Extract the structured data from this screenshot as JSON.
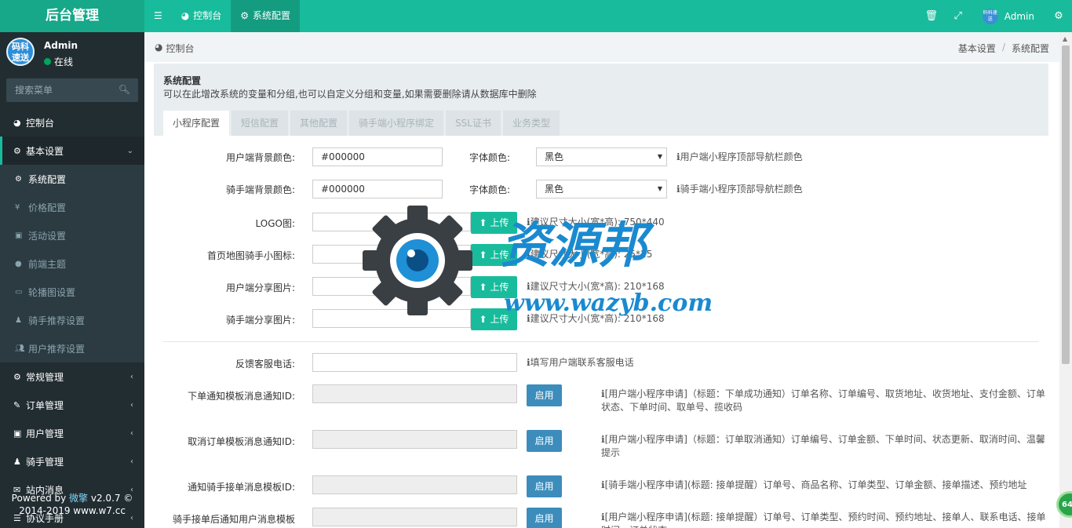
{
  "header": {
    "logo": "后台管理",
    "nav": [
      {
        "label": "控制台",
        "icon": "dashboard-icon"
      },
      {
        "label": "系统配置",
        "icon": "gear-icon"
      }
    ],
    "user_name": "Admin",
    "avatar_text": "码科速送"
  },
  "sidebar": {
    "avatar_text": "码科速送",
    "user_name": "Admin",
    "status": "在线",
    "search_placeholder": "搜索菜单",
    "items": [
      {
        "label": "控制台",
        "icon": "dashboard-icon"
      },
      {
        "label": "基本设置",
        "icon": "gear-icon",
        "open": true
      },
      {
        "label": "常规管理",
        "icon": "gears-icon"
      },
      {
        "label": "订单管理",
        "icon": "edit-icon"
      },
      {
        "label": "用户管理",
        "icon": "user-icon"
      },
      {
        "label": "骑手管理",
        "icon": "rider-icon"
      },
      {
        "label": "站内消息",
        "icon": "message-icon"
      },
      {
        "label": "协议手册",
        "icon": "list-icon"
      }
    ],
    "sub_items": [
      {
        "label": "系统配置",
        "icon": "gear-icon",
        "active": true
      },
      {
        "label": "价格配置",
        "icon": "yen-icon"
      },
      {
        "label": "活动设置",
        "icon": "gift-icon"
      },
      {
        "label": "前端主题",
        "icon": "palette-icon"
      },
      {
        "label": "轮播图设置",
        "icon": "image-icon"
      },
      {
        "label": "骑手推荐设置",
        "icon": "rider-icon"
      },
      {
        "label": "用户推荐设置",
        "icon": "users-icon"
      }
    ],
    "powered_prefix": "Powered by ",
    "powered_brand": "微擎",
    "powered_version": " v2.0.7 ©",
    "powered_line2": "2014-2019 www.w7.cc"
  },
  "breadcrumb": {
    "left": "控制台",
    "right": [
      "基本设置",
      "系统配置"
    ]
  },
  "panel": {
    "title": "系统配置",
    "description": "可以在此增改系统的变量和分组,也可以自定义分组和变量,如果需要删除请从数据库中删除",
    "tabs": [
      "小程序配置",
      "短信配置",
      "其他配置",
      "骑手端小程序绑定",
      "SSL证书",
      "业务类型"
    ]
  },
  "form": {
    "user_bg_label": "用户端背景颜色:",
    "user_bg_value": "#000000",
    "font_color_label": "字体颜色:",
    "user_font_color": "黑色",
    "user_hint": "用户端小程序顶部导航栏颜色",
    "rider_bg_label": "骑手端背景颜色:",
    "rider_bg_value": "#000000",
    "rider_font_color": "黑色",
    "rider_hint": "骑手端小程序顶部导航栏颜色",
    "upload_label": "上传",
    "logo_label": "LOGO图:",
    "logo_hint": "建议尺寸大小(宽*高): 750*440",
    "map_icon_label": "首页地图骑手小图标:",
    "map_icon_hint": "建议尺寸大小(宽*高): 25*25",
    "user_share_label": "用户端分享图片:",
    "user_share_hint": "建议尺寸大小(宽*高): 210*168",
    "rider_share_label": "骑手端分享图片:",
    "rider_share_hint": "建议尺寸大小(宽*高): 210*168",
    "phone_label": "反馈客服电话:",
    "phone_hint": "填写用户端联系客服电话",
    "enable_label": "启用",
    "order_tpl_label": "下单通知模板消息通知ID:",
    "order_tpl_hint": "[用户端小程序申请]（标题：下单成功通知）订单名称、订单编号、取货地址、收货地址、支付金额、订单状态、下单时间、取单号、揽收码",
    "cancel_tpl_label": "取消订单模板消息通知ID:",
    "cancel_tpl_hint": "[用户端小程序申请]（标题：订单取消通知）订单编号、订单金额、下单时间、状态更新、取消时间、温馨提示",
    "rider_tpl_label": "通知骑手接单消息模板ID:",
    "rider_tpl_hint": "[骑手端小程序申请](标题: 接单提醒）订单号、商品名称、订单类型、订单金额、接单描述、预约地址",
    "rider_accept_label": "骑手接单后通知用户消息模板",
    "rider_accept_hint": "[用户端小程序申请](标题: 接单提醒）订单号、订单类型、预约时间、预约地址、接单人、联系电话、接单时间、订单状态"
  },
  "watermark": {
    "brand": "资源邦",
    "url": "www.wazyb.com"
  },
  "floating_badge": "64"
}
